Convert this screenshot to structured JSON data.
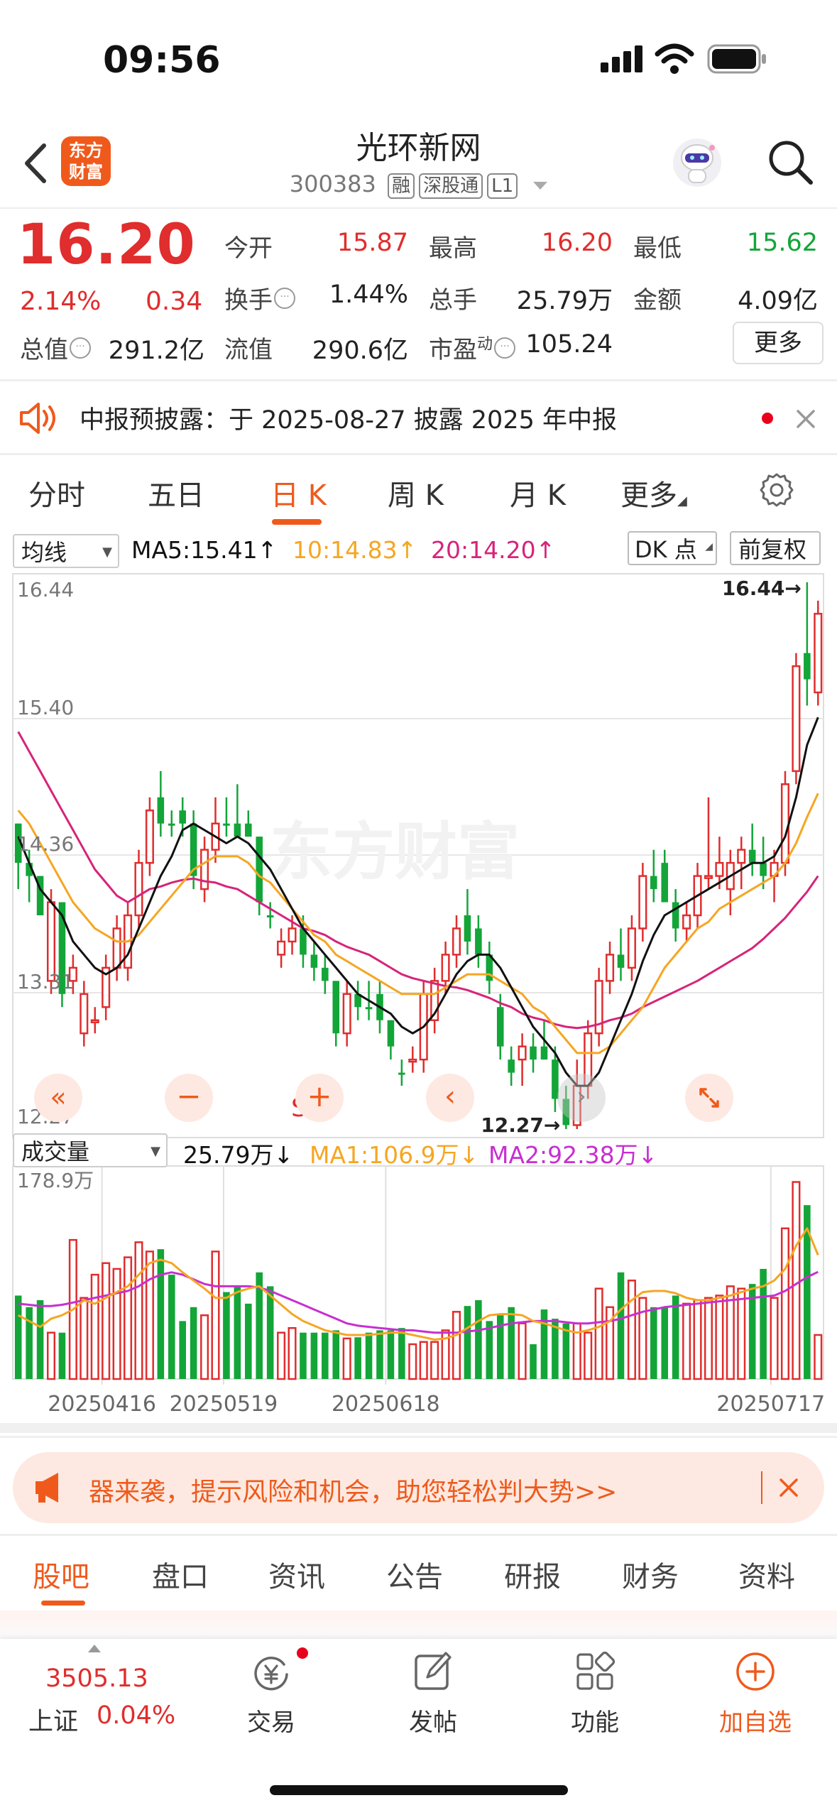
{
  "status": {
    "time": "09:56"
  },
  "header": {
    "logo_line1": "东方",
    "logo_line2": "财富",
    "stock_name": "光环新网",
    "code": "300383",
    "tags": [
      "融",
      "深股通",
      "L1"
    ]
  },
  "quote": {
    "price": "16.20",
    "change_pct": "2.14%",
    "change": "0.34",
    "rows": [
      [
        {
          "label": "今开",
          "value": "15.87",
          "color": "red"
        },
        {
          "label": "最高",
          "value": "16.20",
          "color": "red"
        },
        {
          "label": "最低",
          "value": "15.62",
          "color": "green"
        }
      ],
      [
        {
          "label": "换手",
          "value": "1.44%",
          "color": "dark"
        },
        {
          "label": "总手",
          "value": "25.79万",
          "color": "dark"
        },
        {
          "label": "金额",
          "value": "4.09亿",
          "color": "dark"
        }
      ],
      [
        {
          "label": "总值",
          "value": "291.2亿",
          "color": "dark"
        },
        {
          "label": "流值",
          "value": "290.6亿",
          "color": "dark"
        },
        {
          "label": "市盈",
          "sup": "动",
          "value": "105.24",
          "color": "dark"
        }
      ]
    ],
    "more_button": "更多"
  },
  "notice": {
    "text": "中报预披露：于 2025-08-27 披露 2025 年中报"
  },
  "period_tabs": [
    "分时",
    "五日",
    "日 K",
    "周 K",
    "月 K",
    "更多"
  ],
  "active_period": "日 K",
  "chart_controls": {
    "indicator_select": "均线",
    "ma5": "MA5:15.41",
    "ma10": "10:14.83",
    "ma20": "20:14.20",
    "dk_button": "DK 点",
    "adjust_button": "前复权",
    "volume_select": "成交量",
    "vol_now": "25.79万",
    "vol_ma1": "MA1:106.9万",
    "vol_ma2": "MA2:92.38万",
    "s_mark": "S"
  },
  "chart_data": {
    "type": "candlestick",
    "price_axis_labels": [
      "16.44",
      "15.40",
      "14.36",
      "13.31",
      "12.27"
    ],
    "price_range": [
      12.27,
      16.44
    ],
    "high_marker": "16.44→",
    "low_marker": "12.27→",
    "volume_axis_label": "178.9万",
    "volume_max": 178.9,
    "date_labels": [
      "20250416",
      "20250519",
      "20250618",
      "20250717"
    ],
    "colors": {
      "up": "#e02d2d",
      "down": "#13a538",
      "ma5": "#111111",
      "ma10": "#f5a623",
      "ma20": "#d6247a",
      "vol_ma1": "#f5a623",
      "vol_ma2": "#c72fd1"
    },
    "ohlc": [
      [
        14.6,
        14.6,
        14.1,
        14.3
      ],
      [
        14.3,
        14.4,
        14.0,
        14.2
      ],
      [
        14.2,
        14.2,
        13.9,
        13.9
      ],
      [
        13.4,
        14.1,
        13.3,
        14.0
      ],
      [
        14.0,
        14.0,
        13.2,
        13.3
      ],
      [
        13.4,
        13.6,
        13.3,
        13.5
      ],
      [
        13.3,
        13.4,
        12.9,
        13.0
      ],
      [
        13.1,
        13.2,
        13.0,
        13.1
      ],
      [
        13.2,
        13.6,
        13.1,
        13.5
      ],
      [
        13.5,
        13.9,
        13.4,
        13.8
      ],
      [
        13.5,
        14.0,
        13.4,
        13.9
      ],
      [
        13.9,
        14.4,
        13.8,
        14.3
      ],
      [
        14.3,
        14.8,
        14.2,
        14.7
      ],
      [
        14.8,
        15.0,
        14.5,
        14.6
      ],
      [
        14.6,
        14.7,
        14.5,
        14.6
      ],
      [
        14.7,
        14.8,
        14.5,
        14.6
      ],
      [
        14.6,
        14.7,
        14.1,
        14.2
      ],
      [
        14.1,
        14.5,
        14.0,
        14.4
      ],
      [
        14.4,
        14.8,
        14.3,
        14.6
      ],
      [
        14.6,
        14.8,
        14.5,
        14.6
      ],
      [
        14.6,
        14.9,
        14.5,
        14.5
      ],
      [
        14.6,
        14.7,
        14.5,
        14.5
      ],
      [
        14.5,
        14.5,
        13.9,
        14.0
      ],
      [
        13.9,
        14.0,
        13.8,
        13.9
      ],
      [
        13.6,
        13.8,
        13.5,
        13.7
      ],
      [
        13.7,
        13.9,
        13.6,
        13.8
      ],
      [
        13.8,
        13.9,
        13.5,
        13.6
      ],
      [
        13.6,
        13.7,
        13.4,
        13.5
      ],
      [
        13.5,
        13.6,
        13.3,
        13.4
      ],
      [
        13.4,
        13.4,
        12.9,
        13.0
      ],
      [
        13.0,
        13.4,
        12.9,
        13.3
      ],
      [
        13.3,
        13.4,
        13.1,
        13.2
      ],
      [
        13.2,
        13.4,
        13.1,
        13.2
      ],
      [
        13.3,
        13.4,
        13.0,
        13.1
      ],
      [
        13.1,
        13.1,
        12.8,
        12.9
      ],
      [
        12.7,
        12.8,
        12.6,
        12.7
      ],
      [
        12.8,
        12.9,
        12.7,
        12.8
      ],
      [
        12.8,
        13.4,
        12.7,
        13.3
      ],
      [
        13.1,
        13.5,
        13.0,
        13.4
      ],
      [
        13.4,
        13.7,
        13.3,
        13.6
      ],
      [
        13.6,
        13.9,
        13.5,
        13.8
      ],
      [
        13.9,
        14.1,
        13.6,
        13.7
      ],
      [
        13.8,
        13.9,
        13.5,
        13.6
      ],
      [
        13.6,
        13.7,
        13.3,
        13.4
      ],
      [
        13.2,
        13.3,
        12.8,
        12.9
      ],
      [
        12.8,
        12.9,
        12.6,
        12.7
      ],
      [
        12.8,
        13.0,
        12.6,
        12.9
      ],
      [
        12.9,
        13.0,
        12.7,
        12.8
      ],
      [
        12.9,
        13.1,
        12.8,
        12.8
      ],
      [
        12.8,
        12.9,
        12.4,
        12.5
      ],
      [
        12.5,
        12.6,
        12.27,
        12.3
      ],
      [
        12.3,
        12.8,
        12.27,
        12.6
      ],
      [
        12.6,
        13.1,
        12.5,
        13.0
      ],
      [
        13.0,
        13.5,
        12.9,
        13.4
      ],
      [
        13.4,
        13.7,
        13.3,
        13.6
      ],
      [
        13.6,
        13.8,
        13.4,
        13.5
      ],
      [
        13.5,
        13.9,
        13.4,
        13.8
      ],
      [
        13.8,
        14.3,
        13.7,
        14.2
      ],
      [
        14.2,
        14.4,
        14.0,
        14.1
      ],
      [
        14.3,
        14.4,
        14.0,
        14.0
      ],
      [
        14.0,
        14.1,
        13.7,
        13.8
      ],
      [
        13.8,
        14.0,
        13.7,
        13.9
      ],
      [
        13.9,
        14.3,
        13.8,
        14.2
      ],
      [
        14.2,
        14.8,
        14.1,
        14.2
      ],
      [
        14.2,
        14.5,
        14.1,
        14.3
      ],
      [
        14.1,
        14.4,
        13.9,
        14.3
      ],
      [
        14.3,
        14.5,
        14.1,
        14.4
      ],
      [
        14.4,
        14.6,
        14.2,
        14.3
      ],
      [
        14.3,
        14.5,
        14.1,
        14.2
      ],
      [
        14.2,
        14.4,
        14.0,
        14.3
      ],
      [
        14.3,
        15.0,
        14.2,
        14.9
      ],
      [
        15.0,
        15.9,
        14.9,
        15.8
      ],
      [
        15.9,
        16.44,
        15.5,
        15.7
      ],
      [
        15.6,
        16.3,
        15.5,
        16.2
      ]
    ],
    "volume": [
      72,
      62,
      68,
      40,
      40,
      120,
      70,
      90,
      100,
      95,
      105,
      118,
      110,
      112,
      90,
      50,
      62,
      55,
      110,
      75,
      80,
      65,
      92,
      80,
      40,
      44,
      40,
      40,
      40,
      42,
      35,
      36,
      40,
      42,
      42,
      44,
      30,
      32,
      32,
      42,
      58,
      63,
      68,
      50,
      55,
      62,
      48,
      30,
      60,
      52,
      48,
      48,
      40,
      78,
      62,
      92,
      85,
      70,
      62,
      62,
      72,
      65,
      68,
      70,
      72,
      80,
      78,
      82,
      95,
      70,
      130,
      170,
      150,
      38
    ],
    "up_flags": [
      false,
      false,
      false,
      true,
      false,
      true,
      true,
      true,
      true,
      true,
      true,
      true,
      true,
      false,
      false,
      false,
      false,
      true,
      true,
      false,
      false,
      false,
      false,
      false,
      true,
      true,
      false,
      false,
      false,
      false,
      true,
      false,
      false,
      false,
      false,
      false,
      true,
      true,
      true,
      true,
      true,
      false,
      false,
      false,
      false,
      false,
      true,
      false,
      false,
      false,
      false,
      true,
      true,
      true,
      true,
      false,
      true,
      true,
      false,
      false,
      false,
      true,
      true,
      true,
      true,
      true,
      true,
      false,
      false,
      true,
      true,
      true,
      false,
      true
    ],
    "ma5": [
      14.5,
      14.3,
      14.1,
      14.0,
      13.9,
      13.7,
      13.6,
      13.5,
      13.45,
      13.5,
      13.6,
      13.8,
      14.0,
      14.2,
      14.35,
      14.55,
      14.6,
      14.55,
      14.5,
      14.45,
      14.5,
      14.45,
      14.35,
      14.25,
      14.1,
      13.95,
      13.8,
      13.7,
      13.6,
      13.5,
      13.4,
      13.3,
      13.25,
      13.2,
      13.15,
      13.05,
      13.0,
      13.05,
      13.15,
      13.3,
      13.45,
      13.55,
      13.6,
      13.6,
      13.5,
      13.35,
      13.2,
      13.05,
      12.95,
      12.85,
      12.7,
      12.6,
      12.6,
      12.7,
      12.9,
      13.1,
      13.3,
      13.55,
      13.75,
      13.9,
      13.95,
      14.0,
      14.05,
      14.1,
      14.15,
      14.2,
      14.25,
      14.3,
      14.3,
      14.35,
      14.5,
      14.8,
      15.2,
      15.41
    ],
    "ma10": [
      14.7,
      14.6,
      14.45,
      14.3,
      14.15,
      14.0,
      13.9,
      13.8,
      13.75,
      13.7,
      13.7,
      13.75,
      13.85,
      13.95,
      14.05,
      14.15,
      14.25,
      14.3,
      14.35,
      14.35,
      14.35,
      14.3,
      14.2,
      14.15,
      14.05,
      13.95,
      13.85,
      13.75,
      13.7,
      13.6,
      13.55,
      13.5,
      13.45,
      13.4,
      13.35,
      13.3,
      13.3,
      13.3,
      13.3,
      13.35,
      13.4,
      13.45,
      13.45,
      13.45,
      13.4,
      13.35,
      13.3,
      13.2,
      13.15,
      13.05,
      12.95,
      12.85,
      12.85,
      12.85,
      12.9,
      13.0,
      13.1,
      13.2,
      13.35,
      13.5,
      13.6,
      13.7,
      13.8,
      13.85,
      13.95,
      14.0,
      14.05,
      14.1,
      14.15,
      14.2,
      14.3,
      14.45,
      14.65,
      14.83
    ],
    "ma20": [
      15.3,
      15.15,
      15.0,
      14.85,
      14.7,
      14.55,
      14.4,
      14.25,
      14.15,
      14.05,
      14.0,
      14.05,
      14.1,
      14.12,
      14.15,
      14.17,
      14.18,
      14.16,
      14.15,
      14.12,
      14.1,
      14.05,
      14.0,
      13.95,
      13.9,
      13.85,
      13.8,
      13.78,
      13.75,
      13.7,
      13.66,
      13.63,
      13.6,
      13.55,
      13.5,
      13.45,
      13.42,
      13.4,
      13.38,
      13.36,
      13.35,
      13.33,
      13.3,
      13.27,
      13.23,
      13.2,
      13.15,
      13.12,
      13.1,
      13.07,
      13.05,
      13.04,
      13.05,
      13.07,
      13.1,
      13.12,
      13.15,
      13.2,
      13.24,
      13.28,
      13.32,
      13.36,
      13.4,
      13.45,
      13.5,
      13.55,
      13.6,
      13.65,
      13.72,
      13.8,
      13.88,
      13.98,
      14.08,
      14.2
    ],
    "vol_ma1": [
      55,
      50,
      45,
      52,
      55,
      60,
      68,
      65,
      70,
      75,
      80,
      90,
      100,
      103,
      100,
      92,
      85,
      78,
      70,
      70,
      75,
      78,
      80,
      72,
      64,
      56,
      50,
      46,
      42,
      40,
      38,
      38,
      38,
      39,
      40,
      40,
      38,
      36,
      34,
      35,
      38,
      44,
      50,
      55,
      56,
      56,
      55,
      50,
      48,
      45,
      42,
      40,
      42,
      45,
      50,
      60,
      68,
      75,
      76,
      76,
      74,
      70,
      68,
      68,
      70,
      72,
      75,
      78,
      80,
      85,
      95,
      115,
      130,
      106.9
    ],
    "vol_ma2": [
      65,
      64,
      63,
      63,
      64,
      66,
      68,
      70,
      72,
      74,
      76,
      80,
      86,
      90,
      92,
      90,
      86,
      82,
      80,
      80,
      80,
      80,
      79,
      76,
      72,
      68,
      64,
      60,
      56,
      52,
      48,
      46,
      45,
      44,
      43,
      42,
      42,
      41,
      40,
      40,
      40,
      41,
      42,
      44,
      46,
      48,
      49,
      50,
      50,
      50,
      49,
      48,
      48,
      49,
      50,
      52,
      55,
      58,
      60,
      62,
      63,
      64,
      65,
      66,
      67,
      68,
      69,
      70,
      71,
      72,
      76,
      82,
      88,
      92.38
    ]
  },
  "banner": {
    "text": "器来袭，提示风险和机会，助您轻松判大势>>"
  },
  "bottom_tabs": [
    "股吧",
    "盘口",
    "资讯",
    "公告",
    "研报",
    "财务",
    "资料"
  ],
  "bottom_nav": {
    "index_value": "3505.13",
    "index_name": "上证",
    "index_pct": "0.04%",
    "items": [
      "交易",
      "发帖",
      "功能",
      "加自选"
    ]
  }
}
